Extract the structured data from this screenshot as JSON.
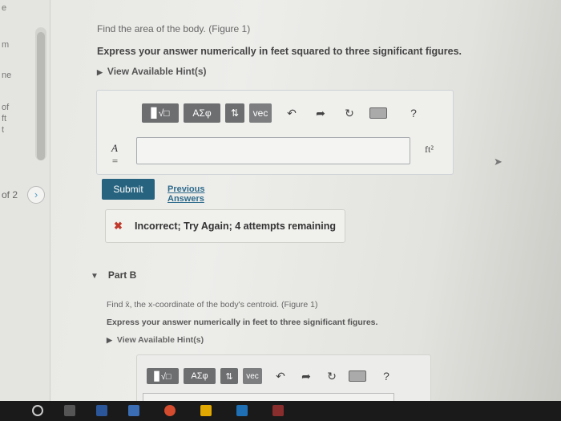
{
  "left_panel": {
    "fragments": [
      "e",
      "m",
      "ne",
      "of",
      "ft",
      "t"
    ],
    "page_indicator": "of 2",
    "next_icon": "chevron-right-icon"
  },
  "part_a": {
    "question": "Find the area of the body. (Figure 1)",
    "instruction": "Express your answer numerically in feet squared to three significant figures.",
    "hints_link": "View Available Hint(s)",
    "toolbar": {
      "templates": "▊√□",
      "greek": "ΑΣφ",
      "arrows": "⇅",
      "vec": "vec",
      "help": "?"
    },
    "variable": "A =",
    "input_value": "",
    "unit": "ft²",
    "submit": "Submit",
    "previous_answers": "Previous Answers",
    "feedback": "Incorrect; Try Again; 4 attempts remaining"
  },
  "part_b": {
    "title": "Part B",
    "question": "Find x̄, the x-coordinate of the body's centroid. (Figure 1)",
    "instruction": "Express your answer numerically in feet to three significant figures.",
    "hints_link": "View Available Hint(s)",
    "toolbar": {
      "templates": "▊√□",
      "greek": "ΑΣφ",
      "arrows": "⇅",
      "vec": "vec",
      "help": "?"
    }
  },
  "colors": {
    "submit": "#27637f",
    "error": "#c0392b",
    "link": "#2f6c8c"
  }
}
